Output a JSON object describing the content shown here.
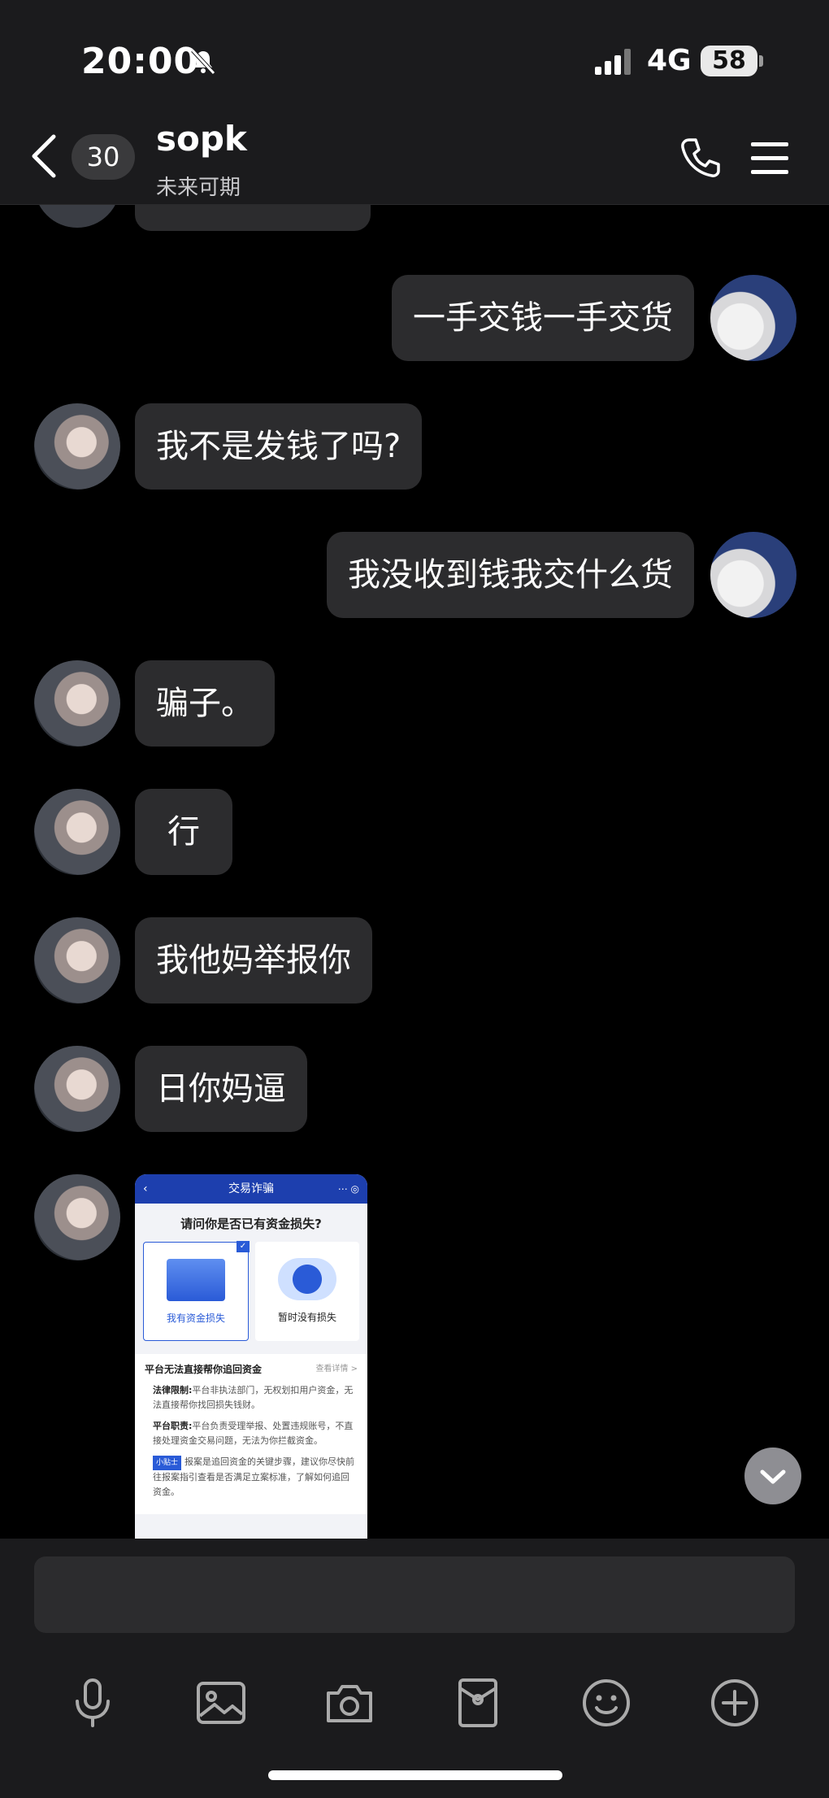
{
  "status_bar": {
    "time": "20:00",
    "network": "4G",
    "battery": "58",
    "icons": [
      "bell-muted-icon",
      "signal-icon",
      "battery-icon"
    ]
  },
  "header": {
    "unread_count": "30",
    "contact_name": "sopk",
    "contact_status": "未来可期",
    "icons": [
      "back-chevron-icon",
      "phone-icon",
      "menu-icon"
    ]
  },
  "messages": [
    {
      "side": "right",
      "text": "一手交钱一手交货"
    },
    {
      "side": "left",
      "text": "我不是发钱了吗?"
    },
    {
      "side": "right",
      "text": "我没收到钱我交什么货"
    },
    {
      "side": "left",
      "text": "骗子。"
    },
    {
      "side": "left",
      "text": "行"
    },
    {
      "side": "left",
      "text": "我他妈举报你"
    },
    {
      "side": "left",
      "text": "日你妈逼"
    }
  ],
  "image_message": {
    "title": "交易诈骗",
    "question": "请问你是否已有资金损失?",
    "option_selected": "我有资金损失",
    "option_other": "暂时没有损失",
    "section_title": "平台无法直接帮你追回资金",
    "section_more": "查看详情 >",
    "point1_label": "法律限制:",
    "point1_text": "平台非执法部门，无权划扣用户资金，无法直接帮你找回损失钱财。",
    "point2_label": "平台职责:",
    "point2_text": "平台负责受理举报、处置违规账号，不直接处理资金交易问题，无法为你拦截资金。",
    "tip_tag": "小贴士",
    "tip_text": "报案是追回资金的关键步骤，建议你尽快前往报案指引查看是否满足立案标准，了解如何追回资金。"
  },
  "input_bar": {
    "tools": [
      "microphone-icon",
      "image-icon",
      "camera-icon",
      "red-packet-icon",
      "emoji-icon",
      "plus-icon"
    ]
  },
  "colors": {
    "background": "#000000",
    "bar": "#1b1b1d",
    "bubble": "#2c2c2e",
    "accent_blue": "#1d3fae"
  }
}
